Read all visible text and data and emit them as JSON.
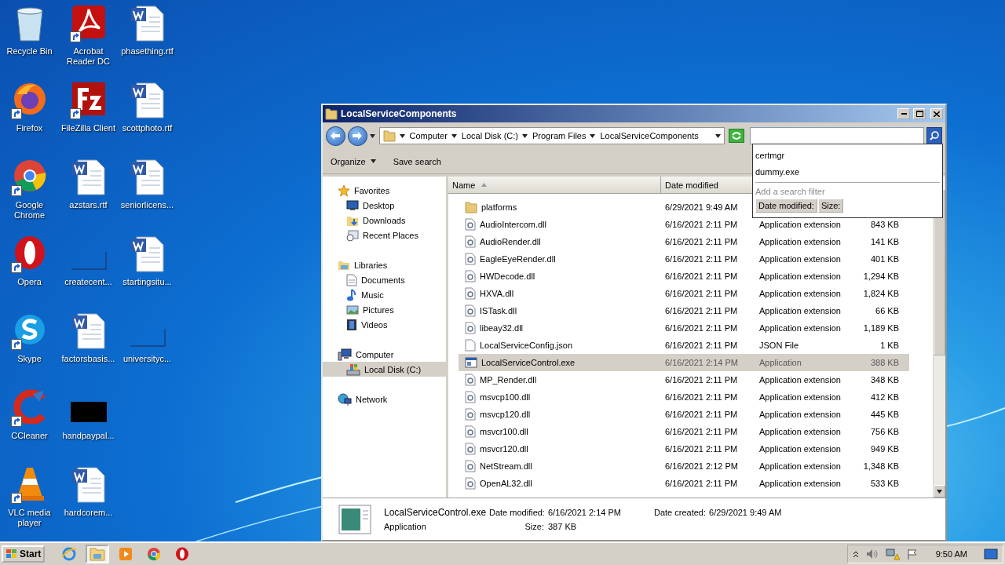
{
  "desktop_icons": [
    {
      "label": "Recycle Bin",
      "kind": "bin",
      "shortcut": false
    },
    {
      "label": "Firefox",
      "kind": "firefox",
      "shortcut": true
    },
    {
      "label": "Google Chrome",
      "kind": "chrome",
      "shortcut": true
    },
    {
      "label": "Opera",
      "kind": "opera",
      "shortcut": true
    },
    {
      "label": "Skype",
      "kind": "skype",
      "shortcut": true
    },
    {
      "label": "CCleaner",
      "kind": "ccleaner",
      "shortcut": true
    },
    {
      "label": "VLC media player",
      "kind": "vlc",
      "shortcut": true
    },
    {
      "label": "Acrobat Reader DC",
      "kind": "acrobat",
      "shortcut": true
    },
    {
      "label": "FileZilla Client",
      "kind": "filezilla",
      "shortcut": true
    },
    {
      "label": "azstars.rtf",
      "kind": "word",
      "shortcut": false
    },
    {
      "label": "createcent...",
      "kind": "blank",
      "shortcut": false
    },
    {
      "label": "factorsbasis...",
      "kind": "word",
      "shortcut": false
    },
    {
      "label": "handpaypal...",
      "kind": "black",
      "shortcut": false
    },
    {
      "label": "hardcorem...",
      "kind": "word",
      "shortcut": false
    },
    {
      "label": "phasething.rtf",
      "kind": "word",
      "shortcut": false
    },
    {
      "label": "scottphoto.rtf",
      "kind": "word",
      "shortcut": false
    },
    {
      "label": "seniorlicens...",
      "kind": "word",
      "shortcut": false
    },
    {
      "label": "startingsitu...",
      "kind": "word",
      "shortcut": false
    },
    {
      "label": "universityc...",
      "kind": "blank",
      "shortcut": false
    }
  ],
  "explorer": {
    "title": "LocalServiceComponents",
    "breadcrumb": [
      "Computer",
      "Local Disk (C:)",
      "Program Files",
      "LocalServiceComponents"
    ],
    "toolbar": [
      {
        "label": "Organize",
        "kind": "menu"
      },
      {
        "label": "Save search",
        "kind": "plain"
      }
    ],
    "sidebar": [
      {
        "label": "Favorites",
        "kind": "star",
        "selected": false,
        "children": [
          {
            "label": "Desktop",
            "kind": "desktop",
            "selected": false
          },
          {
            "label": "Downloads",
            "kind": "downloads",
            "selected": false
          },
          {
            "label": "Recent Places",
            "kind": "recent",
            "selected": false
          }
        ]
      },
      {
        "label": "Libraries",
        "kind": "libraries",
        "selected": false,
        "children": [
          {
            "label": "Documents",
            "kind": "documents",
            "selected": false
          },
          {
            "label": "Music",
            "kind": "music",
            "selected": false
          },
          {
            "label": "Pictures",
            "kind": "pictures",
            "selected": false
          },
          {
            "label": "Videos",
            "kind": "videos",
            "selected": false
          }
        ]
      },
      {
        "label": "Computer",
        "kind": "computer",
        "selected": false,
        "children": [
          {
            "label": "Local Disk (C:)",
            "kind": "disk",
            "selected": true
          }
        ]
      },
      {
        "label": "Network",
        "kind": "network",
        "selected": false
      }
    ],
    "columns": [
      {
        "label": "Name",
        "sorted": true
      },
      {
        "label": "Date modified",
        "sorted": false
      }
    ],
    "files": [
      {
        "name": "platforms",
        "kind": "folder",
        "date": "6/29/2021 9:49 AM",
        "selected": false
      },
      {
        "name": "AudioIntercom.dll",
        "kind": "dll",
        "date": "6/16/2021 2:11 PM",
        "type": "Application extension",
        "size": "843 KB",
        "selected": false
      },
      {
        "name": "AudioRender.dll",
        "kind": "dll",
        "date": "6/16/2021 2:11 PM",
        "type": "Application extension",
        "size": "141 KB",
        "selected": false
      },
      {
        "name": "EagleEyeRender.dll",
        "kind": "dll",
        "date": "6/16/2021 2:11 PM",
        "type": "Application extension",
        "size": "401 KB",
        "selected": false
      },
      {
        "name": "HWDecode.dll",
        "kind": "dll",
        "date": "6/16/2021 2:11 PM",
        "type": "Application extension",
        "size": "1,294 KB",
        "selected": false
      },
      {
        "name": "HXVA.dll",
        "kind": "dll",
        "date": "6/16/2021 2:11 PM",
        "type": "Application extension",
        "size": "1,824 KB",
        "selected": false
      },
      {
        "name": "ISTask.dll",
        "kind": "dll",
        "date": "6/16/2021 2:11 PM",
        "type": "Application extension",
        "size": "66 KB",
        "selected": false
      },
      {
        "name": "libeay32.dll",
        "kind": "dll",
        "date": "6/16/2021 2:11 PM",
        "type": "Application extension",
        "size": "1,189 KB",
        "selected": false
      },
      {
        "name": "LocalServiceConfig.json",
        "kind": "json",
        "date": "6/16/2021 2:11 PM",
        "type": "JSON File",
        "size": "1 KB",
        "selected": false
      },
      {
        "name": "LocalServiceControl.exe",
        "kind": "exe",
        "date": "6/16/2021 2:14 PM",
        "type": "Application",
        "size": "388 KB",
        "selected": true
      },
      {
        "name": "MP_Render.dll",
        "kind": "dll",
        "date": "6/16/2021 2:11 PM",
        "type": "Application extension",
        "size": "348 KB",
        "selected": false
      },
      {
        "name": "msvcp100.dll",
        "kind": "dll",
        "date": "6/16/2021 2:11 PM",
        "type": "Application extension",
        "size": "412 KB",
        "selected": false
      },
      {
        "name": "msvcp120.dll",
        "kind": "dll",
        "date": "6/16/2021 2:11 PM",
        "type": "Application extension",
        "size": "445 KB",
        "selected": false
      },
      {
        "name": "msvcr100.dll",
        "kind": "dll",
        "date": "6/16/2021 2:11 PM",
        "type": "Application extension",
        "size": "756 KB",
        "selected": false
      },
      {
        "name": "msvcr120.dll",
        "kind": "dll",
        "date": "6/16/2021 2:11 PM",
        "type": "Application extension",
        "size": "949 KB",
        "selected": false
      },
      {
        "name": "NetStream.dll",
        "kind": "dll",
        "date": "6/16/2021 2:12 PM",
        "type": "Application extension",
        "size": "1,348 KB",
        "selected": false
      },
      {
        "name": "OpenAL32.dll",
        "kind": "dll",
        "date": "6/16/2021 2:11 PM",
        "type": "Application extension",
        "size": "533 KB",
        "selected": false
      }
    ],
    "search_dropdown": {
      "suggestions": [
        "certmgr",
        "dummy.exe"
      ],
      "filter_hint": "Add a search filter",
      "filters": [
        "Date modified:",
        "Size:"
      ]
    },
    "details": {
      "name": "LocalServiceControl.exe",
      "type": "Application",
      "modified_label": "Date modified:",
      "modified": "6/16/2021 2:14 PM",
      "size_label": "Size:",
      "size": "387 KB",
      "created_label": "Date created:",
      "created": "6/29/2021 9:49 AM"
    }
  },
  "taskbar": {
    "start": "Start",
    "apps": [
      {
        "kind": "ie",
        "active": false
      },
      {
        "kind": "explorer",
        "active": true
      },
      {
        "kind": "media",
        "active": false
      },
      {
        "kind": "chrome",
        "active": false
      },
      {
        "kind": "opera",
        "active": false
      }
    ],
    "clock": "9:50 AM"
  }
}
